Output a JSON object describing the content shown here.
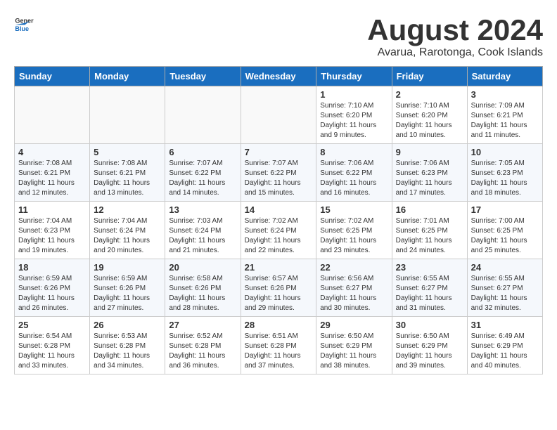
{
  "logo": {
    "general": "General",
    "blue": "Blue"
  },
  "title": "August 2024",
  "subtitle": "Avarua, Rarotonga, Cook Islands",
  "days_of_week": [
    "Sunday",
    "Monday",
    "Tuesday",
    "Wednesday",
    "Thursday",
    "Friday",
    "Saturday"
  ],
  "weeks": [
    [
      {
        "day": "",
        "info": ""
      },
      {
        "day": "",
        "info": ""
      },
      {
        "day": "",
        "info": ""
      },
      {
        "day": "",
        "info": ""
      },
      {
        "day": "1",
        "info": "Sunrise: 7:10 AM\nSunset: 6:20 PM\nDaylight: 11 hours\nand 9 minutes."
      },
      {
        "day": "2",
        "info": "Sunrise: 7:10 AM\nSunset: 6:20 PM\nDaylight: 11 hours\nand 10 minutes."
      },
      {
        "day": "3",
        "info": "Sunrise: 7:09 AM\nSunset: 6:21 PM\nDaylight: 11 hours\nand 11 minutes."
      }
    ],
    [
      {
        "day": "4",
        "info": "Sunrise: 7:08 AM\nSunset: 6:21 PM\nDaylight: 11 hours\nand 12 minutes."
      },
      {
        "day": "5",
        "info": "Sunrise: 7:08 AM\nSunset: 6:21 PM\nDaylight: 11 hours\nand 13 minutes."
      },
      {
        "day": "6",
        "info": "Sunrise: 7:07 AM\nSunset: 6:22 PM\nDaylight: 11 hours\nand 14 minutes."
      },
      {
        "day": "7",
        "info": "Sunrise: 7:07 AM\nSunset: 6:22 PM\nDaylight: 11 hours\nand 15 minutes."
      },
      {
        "day": "8",
        "info": "Sunrise: 7:06 AM\nSunset: 6:22 PM\nDaylight: 11 hours\nand 16 minutes."
      },
      {
        "day": "9",
        "info": "Sunrise: 7:06 AM\nSunset: 6:23 PM\nDaylight: 11 hours\nand 17 minutes."
      },
      {
        "day": "10",
        "info": "Sunrise: 7:05 AM\nSunset: 6:23 PM\nDaylight: 11 hours\nand 18 minutes."
      }
    ],
    [
      {
        "day": "11",
        "info": "Sunrise: 7:04 AM\nSunset: 6:23 PM\nDaylight: 11 hours\nand 19 minutes."
      },
      {
        "day": "12",
        "info": "Sunrise: 7:04 AM\nSunset: 6:24 PM\nDaylight: 11 hours\nand 20 minutes."
      },
      {
        "day": "13",
        "info": "Sunrise: 7:03 AM\nSunset: 6:24 PM\nDaylight: 11 hours\nand 21 minutes."
      },
      {
        "day": "14",
        "info": "Sunrise: 7:02 AM\nSunset: 6:24 PM\nDaylight: 11 hours\nand 22 minutes."
      },
      {
        "day": "15",
        "info": "Sunrise: 7:02 AM\nSunset: 6:25 PM\nDaylight: 11 hours\nand 23 minutes."
      },
      {
        "day": "16",
        "info": "Sunrise: 7:01 AM\nSunset: 6:25 PM\nDaylight: 11 hours\nand 24 minutes."
      },
      {
        "day": "17",
        "info": "Sunrise: 7:00 AM\nSunset: 6:25 PM\nDaylight: 11 hours\nand 25 minutes."
      }
    ],
    [
      {
        "day": "18",
        "info": "Sunrise: 6:59 AM\nSunset: 6:26 PM\nDaylight: 11 hours\nand 26 minutes."
      },
      {
        "day": "19",
        "info": "Sunrise: 6:59 AM\nSunset: 6:26 PM\nDaylight: 11 hours\nand 27 minutes."
      },
      {
        "day": "20",
        "info": "Sunrise: 6:58 AM\nSunset: 6:26 PM\nDaylight: 11 hours\nand 28 minutes."
      },
      {
        "day": "21",
        "info": "Sunrise: 6:57 AM\nSunset: 6:26 PM\nDaylight: 11 hours\nand 29 minutes."
      },
      {
        "day": "22",
        "info": "Sunrise: 6:56 AM\nSunset: 6:27 PM\nDaylight: 11 hours\nand 30 minutes."
      },
      {
        "day": "23",
        "info": "Sunrise: 6:55 AM\nSunset: 6:27 PM\nDaylight: 11 hours\nand 31 minutes."
      },
      {
        "day": "24",
        "info": "Sunrise: 6:55 AM\nSunset: 6:27 PM\nDaylight: 11 hours\nand 32 minutes."
      }
    ],
    [
      {
        "day": "25",
        "info": "Sunrise: 6:54 AM\nSunset: 6:28 PM\nDaylight: 11 hours\nand 33 minutes."
      },
      {
        "day": "26",
        "info": "Sunrise: 6:53 AM\nSunset: 6:28 PM\nDaylight: 11 hours\nand 34 minutes."
      },
      {
        "day": "27",
        "info": "Sunrise: 6:52 AM\nSunset: 6:28 PM\nDaylight: 11 hours\nand 36 minutes."
      },
      {
        "day": "28",
        "info": "Sunrise: 6:51 AM\nSunset: 6:28 PM\nDaylight: 11 hours\nand 37 minutes."
      },
      {
        "day": "29",
        "info": "Sunrise: 6:50 AM\nSunset: 6:29 PM\nDaylight: 11 hours\nand 38 minutes."
      },
      {
        "day": "30",
        "info": "Sunrise: 6:50 AM\nSunset: 6:29 PM\nDaylight: 11 hours\nand 39 minutes."
      },
      {
        "day": "31",
        "info": "Sunrise: 6:49 AM\nSunset: 6:29 PM\nDaylight: 11 hours\nand 40 minutes."
      }
    ]
  ]
}
